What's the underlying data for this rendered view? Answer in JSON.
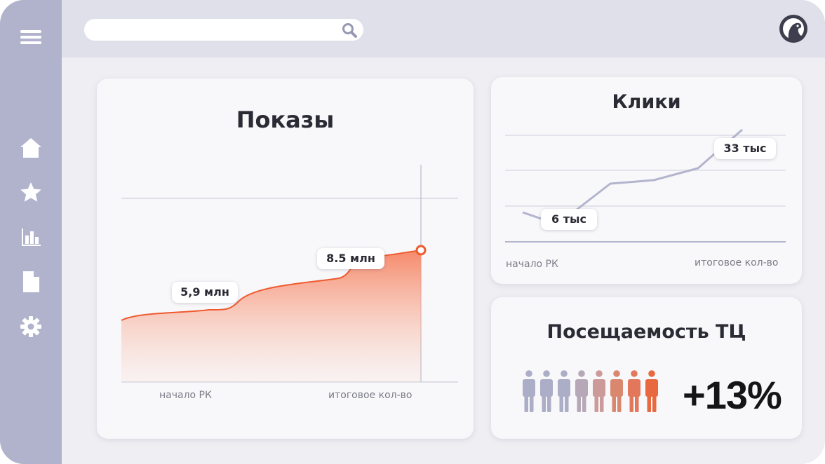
{
  "search": {
    "placeholder": ""
  },
  "sidebar": {
    "items": [
      {
        "icon": "home-icon"
      },
      {
        "icon": "star-icon"
      },
      {
        "icon": "bar-chart-icon"
      },
      {
        "icon": "document-icon"
      },
      {
        "icon": "gear-icon"
      }
    ]
  },
  "cards": {
    "impressions": {
      "title": "Показы",
      "x_start_label": "начало РК",
      "x_end_label": "итоговое кол-во",
      "tag_1": "5,9 млн",
      "tag_2": "8.5 млн"
    },
    "clicks": {
      "title": "Клики",
      "x_start_label": "начало РК",
      "x_end_label": "итоговое кол-во",
      "tag_1": "6 тыс",
      "tag_2": "33 тыс"
    },
    "traffic": {
      "title": "Посещаемость ТЦ",
      "value": "+13%",
      "people_count": 8
    }
  },
  "colors": {
    "accent": "#ef5a2e",
    "line_secondary": "#b3b4ce",
    "sidebar": "#b1b3cd"
  }
}
